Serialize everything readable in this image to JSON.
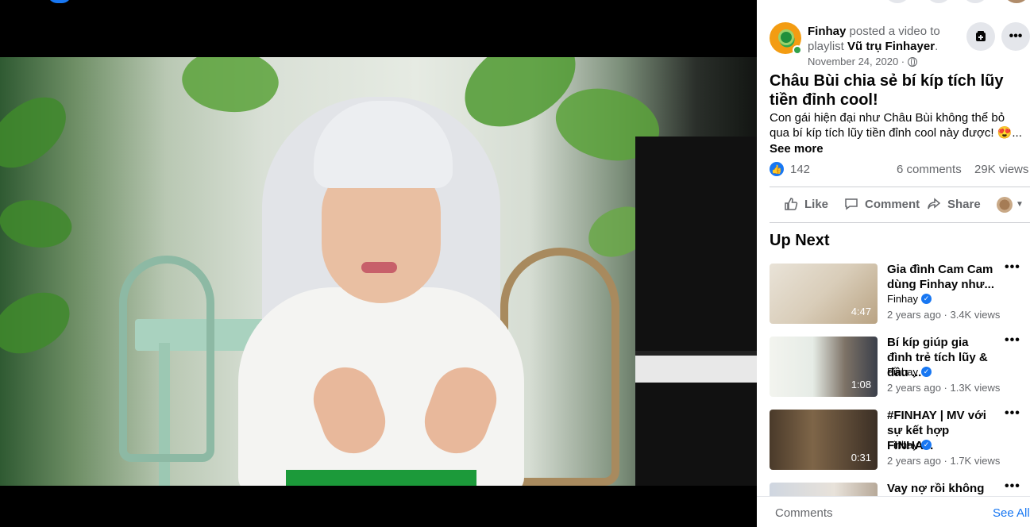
{
  "post": {
    "page_name": "Finhay",
    "posted_text": "posted a video to",
    "playlist_prefix": "playlist",
    "playlist_name": "Vũ trụ Finhayer",
    "date": "November 24, 2020 ·",
    "title": "Châu Bùi chia sẻ bí kíp tích lũy tiền đỉnh cool!",
    "description": "Con gái hiện đại như Châu Bùi không thể bỏ qua bí kíp tích lũy tiền đỉnh cool này được! 😍...",
    "see_more": "See more",
    "likes": "142",
    "comments": "6 comments",
    "views": "29K views"
  },
  "actions": {
    "like": "Like",
    "comment": "Comment",
    "share": "Share"
  },
  "icons": {
    "save": "save-icon",
    "more": "more-icon",
    "like": "thumbs-up-icon",
    "comment": "comment-icon",
    "share": "share-icon",
    "globe": "globe-icon",
    "verified": "verified-badge-icon"
  },
  "up_next": {
    "heading": "Up Next",
    "items": [
      {
        "title": "Gia đình Cam Cam dùng Finhay như...",
        "channel": "Finhay",
        "info": "2 years ago · 3.4K views",
        "duration": "4:47"
      },
      {
        "title": "Bí kíp giúp gia đình trẻ tích lũy & đầu ...",
        "channel": "Finhay",
        "info": "2 years ago · 1.3K views",
        "duration": "1:08"
      },
      {
        "title": "#FINHAY | MV với sự kết hợp FINHA...",
        "channel": "Finhay",
        "info": "2 years ago · 1.7K views",
        "duration": "0:31"
      },
      {
        "title": "Vay nợ rồi không",
        "channel": "",
        "info": "",
        "duration": ""
      }
    ]
  },
  "footer": {
    "comments_label": "Comments",
    "see_all": "See All"
  },
  "colors": {
    "accent": "#1877f2",
    "secondary_text": "#65676b",
    "online": "#31a24c"
  }
}
